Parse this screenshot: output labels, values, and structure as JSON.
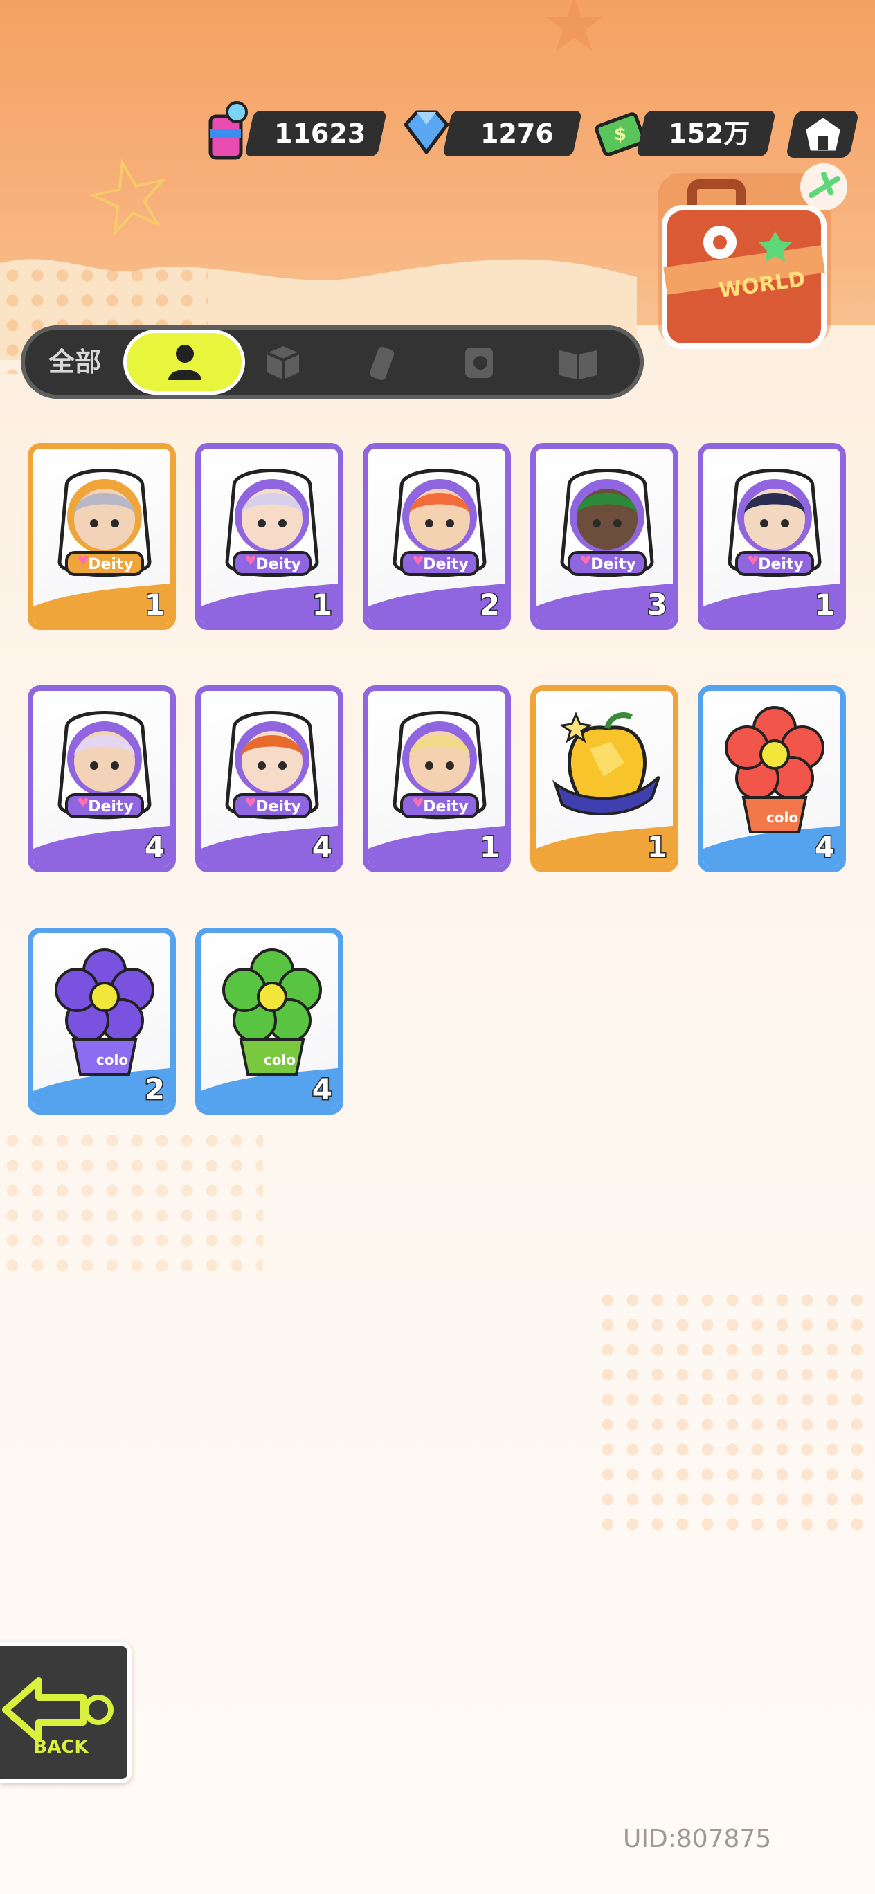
{
  "currencies": [
    {
      "name": "paint-currency",
      "value": "11623"
    },
    {
      "name": "diamond-currency",
      "value": "1276"
    },
    {
      "name": "cash-currency",
      "value": "152万"
    }
  ],
  "world_label": "WORLD",
  "tabs": {
    "all_label": "全部",
    "icons": [
      "person-icon",
      "box-icon",
      "spray-icon",
      "sticker-icon",
      "book-icon"
    ],
    "active_index": 0
  },
  "items": [
    {
      "type": "character",
      "frame": "orange",
      "badge": "Deity",
      "count": "1"
    },
    {
      "type": "character",
      "frame": "purple",
      "badge": "Deity",
      "count": "1"
    },
    {
      "type": "character",
      "frame": "purple",
      "badge": "Deity",
      "count": "2"
    },
    {
      "type": "character",
      "frame": "purple",
      "badge": "Deity",
      "count": "3"
    },
    {
      "type": "character",
      "frame": "purple",
      "badge": "Deity",
      "count": "1"
    },
    {
      "type": "character",
      "frame": "purple",
      "badge": "Deity",
      "count": "4"
    },
    {
      "type": "character",
      "frame": "purple",
      "badge": "Deity",
      "count": "4"
    },
    {
      "type": "character",
      "frame": "purple",
      "badge": "Deity",
      "count": "1"
    },
    {
      "type": "golden-apple",
      "frame": "orange",
      "count": "1"
    },
    {
      "type": "flower-red",
      "frame": "blue",
      "pot_label": "colo",
      "count": "4"
    },
    {
      "type": "flower-purple",
      "frame": "blue",
      "pot_label": "colo",
      "count": "2"
    },
    {
      "type": "flower-green",
      "frame": "blue",
      "pot_label": "colo",
      "count": "4"
    }
  ],
  "back_label": "BACK",
  "uid": "UID:807875",
  "colors": {
    "accent": "#e7f53d",
    "purple": "#9066e0",
    "orange": "#f0a53a",
    "blue": "#55a3ee",
    "header": "#f4a263"
  }
}
